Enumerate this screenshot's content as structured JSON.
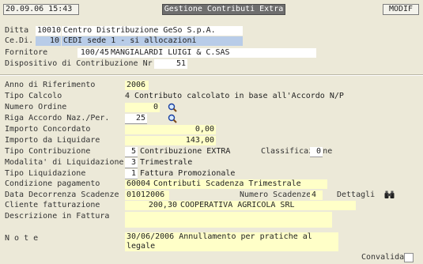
{
  "header": {
    "datetime": "20.09.06 15:43",
    "title": "Gestione Contributi Extra",
    "mode": "MODIF"
  },
  "fields": {
    "ditta_label": "Ditta",
    "ditta_code": "10010",
    "ditta_name": "Centro Distribuzione GeSo S.p.A.",
    "cedi_label": "Ce.Di.",
    "cedi_code": "10",
    "cedi_name": "CEDI sede 1 - si allocazioni",
    "fornitore_label": "Fornitore",
    "fornitore_code": "100/45",
    "fornitore_name": "MANGIALARDI LUIGI & C.SAS",
    "dispositivo_label": "Dispositivo di Contribuzione Nr.",
    "dispositivo_value": "51",
    "anno_label": "Anno di Riferimento",
    "anno_value": "2006",
    "tipo_calcolo_label": "Tipo Calcolo",
    "tipo_calcolo_code": "4",
    "tipo_calcolo_desc": "Contributo calcolato in base all'Accordo N/P",
    "numero_ordine_label": "Numero Ordine",
    "numero_ordine_value": "0",
    "riga_accordo_label": "Riga Accordo Naz./Per.",
    "riga_accordo_value": "25",
    "importo_concordato_label": "Importo Concordato",
    "importo_concordato_value": "0,00",
    "importo_liquidare_label": "Importo da Liquidare",
    "importo_liquidare_value": "143,00",
    "tipo_contribuzione_label": "Tipo Contribuzione",
    "tipo_contribuzione_code": "5",
    "tipo_contribuzione_desc": "Contribuzione EXTRA",
    "classificazione_label": "Classificazione",
    "classificazione_value": "0",
    "modalita_label": "Modalita' di Liquidazione",
    "modalita_code": "3",
    "modalita_desc": "Trimestrale",
    "tipo_liquidazione_label": "Tipo Liquidazione",
    "tipo_liquidazione_code": "1",
    "tipo_liquidazione_desc": "Fattura Promozionale",
    "condizione_label": "Condizione pagamento",
    "condizione_code": "60004",
    "condizione_desc": "Contributi Scadenza Trimestrale",
    "data_decorrenza_label": "Data Decorrenza Scadenze",
    "data_decorrenza_value": "01012006",
    "numero_scadenze_label": "Numero Scadenze",
    "numero_scadenze_value": "4",
    "dettagli_label": "Dettagli",
    "cliente_label": "Cliente fatturazione",
    "cliente_code": "200,30",
    "cliente_name": "COOPERATIVA AGRICOLA SRL",
    "descrizione_label": "Descrizione in Fattura",
    "descrizione_value": "",
    "note_label": "N o t e",
    "note_value": "30/06/2006 Annullamento per pratiche al legale",
    "convalida_label": "Convalida"
  },
  "icons": {
    "search": "magnifier-icon",
    "details": "binoculars-icon"
  }
}
